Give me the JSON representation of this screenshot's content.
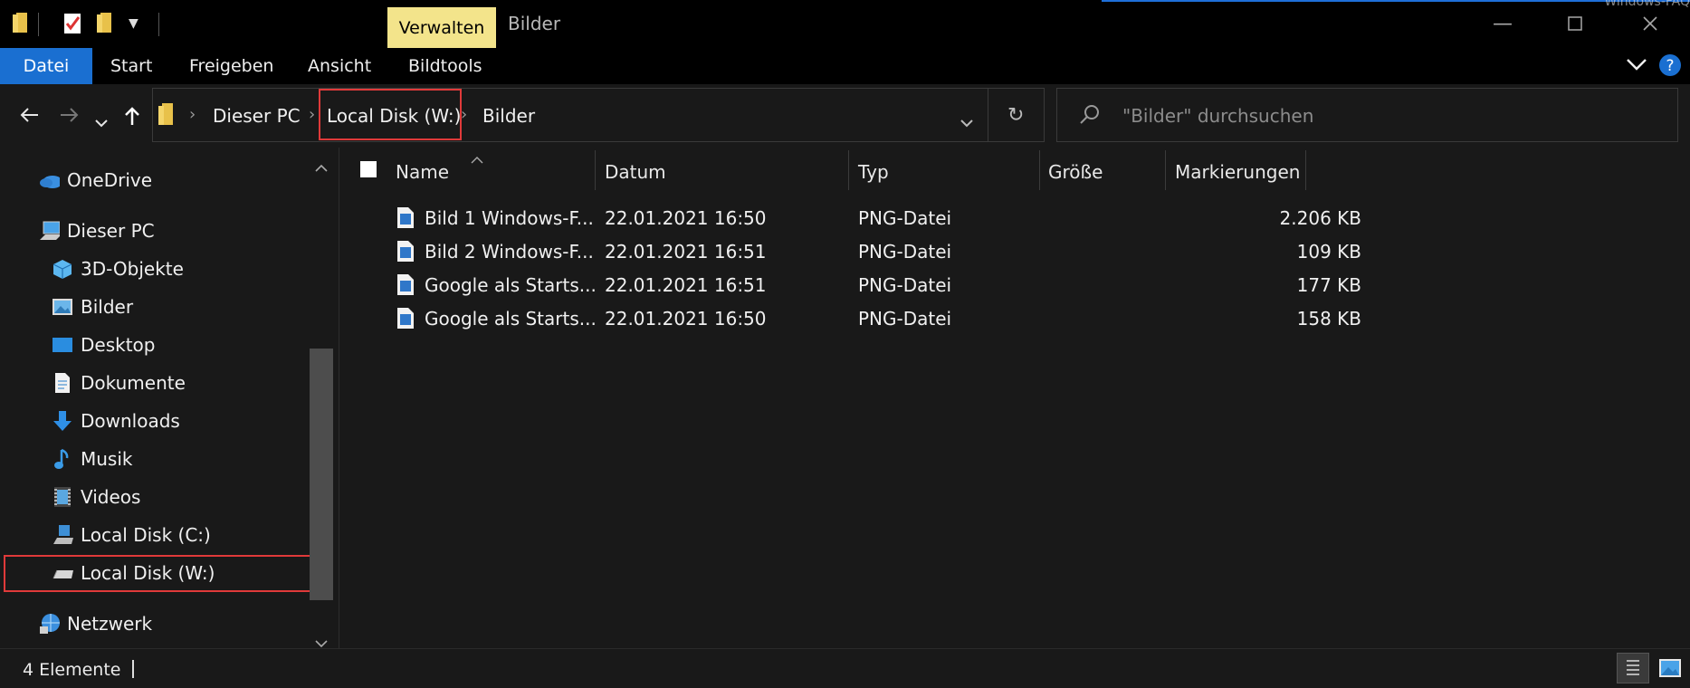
{
  "window": {
    "title": "Bilder",
    "verwalten_tab": "Verwalten",
    "watermark": "Windows-FAQ"
  },
  "ribbon": {
    "tabs": [
      "Datei",
      "Start",
      "Freigeben",
      "Ansicht",
      "Bildtools"
    ]
  },
  "address": {
    "crumbs": [
      "Dieser PC",
      "Local Disk (W:)",
      "Bilder"
    ],
    "search_placeholder": "\"Bilder\" durchsuchen"
  },
  "nav": {
    "items": [
      {
        "label": "OneDrive",
        "icon": "cloud-icon"
      },
      {
        "label": "Dieser PC",
        "icon": "computer-icon"
      },
      {
        "label": "3D-Objekte",
        "icon": "cube-icon"
      },
      {
        "label": "Bilder",
        "icon": "pictures-icon"
      },
      {
        "label": "Desktop",
        "icon": "desktop-icon"
      },
      {
        "label": "Dokumente",
        "icon": "document-icon"
      },
      {
        "label": "Downloads",
        "icon": "download-icon"
      },
      {
        "label": "Musik",
        "icon": "music-icon"
      },
      {
        "label": "Videos",
        "icon": "video-icon"
      },
      {
        "label": "Local Disk (C:)",
        "icon": "system-drive-icon"
      },
      {
        "label": "Local Disk (W:)",
        "icon": "drive-icon"
      },
      {
        "label": "Netzwerk",
        "icon": "network-icon"
      }
    ]
  },
  "columns": [
    "Name",
    "Datum",
    "Typ",
    "Größe",
    "Markierungen"
  ],
  "files": [
    {
      "name": "Bild 1 Windows-F...",
      "date": "22.01.2021 16:50",
      "type": "PNG-Datei",
      "size": "2.206 KB"
    },
    {
      "name": "Bild 2 Windows-F...",
      "date": "22.01.2021 16:51",
      "type": "PNG-Datei",
      "size": "109 KB"
    },
    {
      "name": "Google als Starts...",
      "date": "22.01.2021 16:51",
      "type": "PNG-Datei",
      "size": "177 KB"
    },
    {
      "name": "Google als Starts...",
      "date": "22.01.2021 16:50",
      "type": "PNG-Datei",
      "size": "158 KB"
    }
  ],
  "status": {
    "count": "4 Elemente"
  },
  "colors": {
    "accent": "#1a6fd1",
    "verwalten": "#f3e48b",
    "highlight": "#e03a3a",
    "background": "#191919"
  }
}
